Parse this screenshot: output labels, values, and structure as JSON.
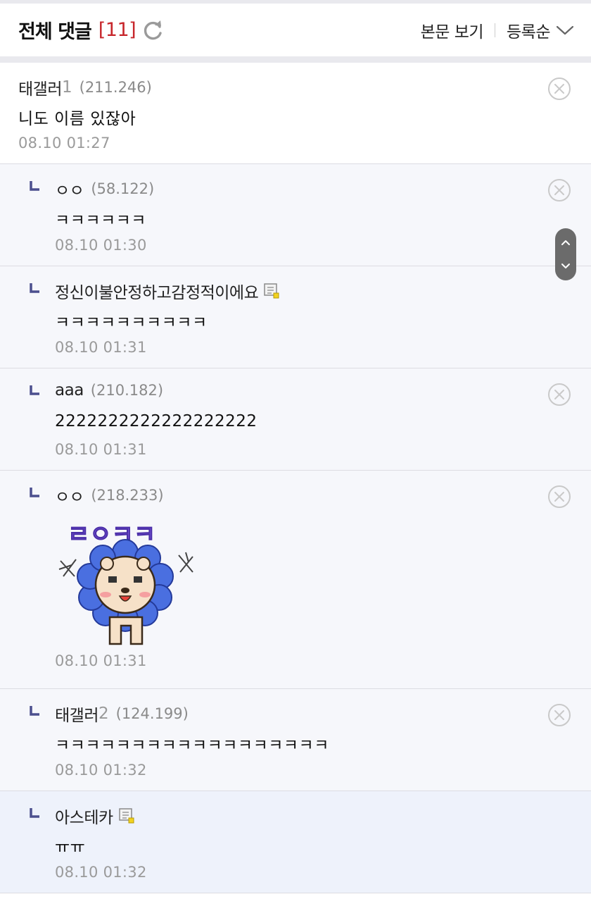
{
  "header": {
    "title": "전체 댓글",
    "count": "[11]",
    "view_body_label": "본문 보기",
    "sort_label": "등록순"
  },
  "colors": {
    "count_red": "#c7262b",
    "reply_bg": "#f6f7fb",
    "highlight_bg": "#eef2fb",
    "reply_mark": "#4b4f8e"
  },
  "comments": [
    {
      "author": "태갤러",
      "author_suffix": "1",
      "ip": "(211.246)",
      "text": "니도 이름 있잖아",
      "time": "08.10 01:27"
    },
    {
      "author": "ㅇㅇ",
      "ip": "(58.122)",
      "text": "ㅋㅋㅋㅋㅋㅋ",
      "time": "08.10 01:30"
    },
    {
      "author": "정신이불안정하고감정적이에요",
      "text": "ㅋㅋㅋㅋㅋㅋㅋㅋㅋㅋ",
      "time": "08.10 01:31",
      "icon": "gallog-icon"
    },
    {
      "author": "aaa",
      "ip": "(210.182)",
      "text": "2222222222222222222",
      "time": "08.10 01:31"
    },
    {
      "author": "ㅇㅇ",
      "ip": "(218.233)",
      "sticker_text": "ㄹㅇㅋㅋ",
      "time": "08.10 01:31"
    },
    {
      "author": "태갤러",
      "author_suffix": "2",
      "ip": "(124.199)",
      "text": "ㅋㅋㅋㅋㅋㅋㅋㅋㅋㅋㅋㅋㅋㅋㅋㅋㅋㅋ",
      "time": "08.10 01:32"
    },
    {
      "author": "아스테카",
      "text": "ㅠㅠ",
      "time": "08.10 01:32",
      "icon": "gallog-icon"
    }
  ]
}
